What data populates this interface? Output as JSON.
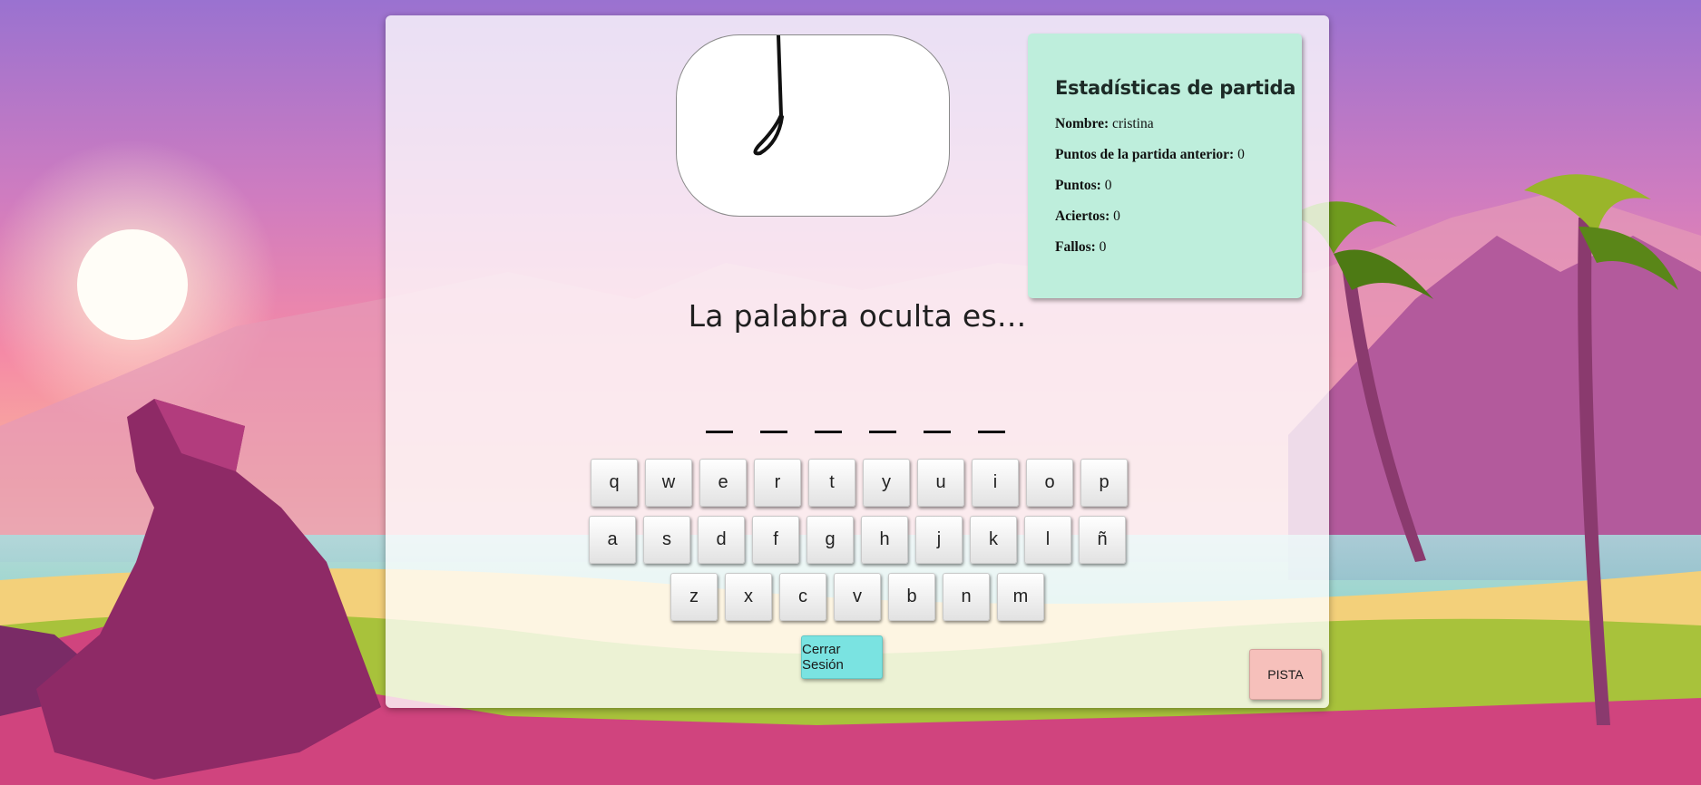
{
  "stats": {
    "title": "Estadísticas de partida",
    "name_label": "Nombre:",
    "name_value": "cristina",
    "previous_points_label": "Puntos de la partida anterior:",
    "previous_points_value": "0",
    "points_label": "Puntos:",
    "points_value": "0",
    "hits_label": "Aciertos:",
    "hits_value": "0",
    "misses_label": "Fallos:",
    "misses_value": "0"
  },
  "game": {
    "headline": "La palabra oculta es...",
    "hidden_word_length": 6
  },
  "keyboard": {
    "row1": [
      "q",
      "w",
      "e",
      "r",
      "t",
      "y",
      "u",
      "i",
      "o",
      "p"
    ],
    "row2": [
      "a",
      "s",
      "d",
      "f",
      "g",
      "h",
      "j",
      "k",
      "l",
      "ñ"
    ],
    "row3": [
      "z",
      "x",
      "c",
      "v",
      "b",
      "n",
      "m"
    ]
  },
  "buttons": {
    "logout_label": "Cerrar Sesión",
    "hint_label": "PISTA"
  },
  "colors": {
    "stats_background": "#beeedc",
    "logout_button": "#7ae3e1",
    "hint_button": "#f6c0bb"
  }
}
